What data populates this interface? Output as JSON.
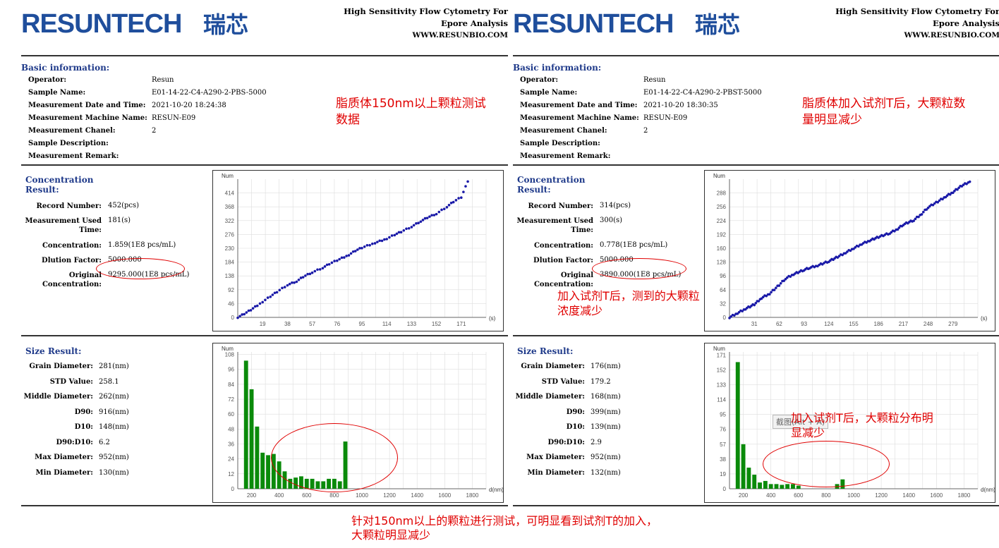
{
  "header": {
    "logo_text": "RESUNTECH 瑞芯",
    "line1": "High Sensitivity Flow Cytometry For",
    "line2": "Epore Analysis",
    "website": "WWW.RESUNBIO.COM"
  },
  "panels": [
    {
      "basic": {
        "title": "Basic information:",
        "rows": [
          {
            "k": "Operator:",
            "v": "Resun"
          },
          {
            "k": "Sample Name:",
            "v": "E01-14-22-C4-A290-2-PBS-5000"
          },
          {
            "k": "Measurement Date and Time:",
            "v": "2021-10-20 18:24:38"
          },
          {
            "k": "Measurement Machine Name:",
            "v": "RESUN-E09"
          },
          {
            "k": "Measurement Chanel:",
            "v": "2"
          },
          {
            "k": "Sample Description:",
            "v": ""
          },
          {
            "k": "Measurement Remark:",
            "v": ""
          }
        ]
      },
      "annotation_top": "脂质体150nm以上颗粒测试数据",
      "concentration": {
        "title_line1": "Concentration",
        "title_line2": "Result:",
        "record_label": "Record Number:",
        "record_value": "452(pcs)",
        "time_label1": "Measurement Used",
        "time_label2": "Time:",
        "time_value": "181(s)",
        "conc_label": "Concentration:",
        "conc_value": "1.859(1E8 pcs/mL)",
        "dil_label": "Dlution Factor:",
        "dil_value": "5000.000",
        "orig_label1": "Original",
        "orig_label2": "Concentration:",
        "orig_value": "9295.000(1E8 pcs/mL)"
      },
      "size": {
        "title": "Size Result:",
        "rows": [
          {
            "k": "Grain Diameter:",
            "v": "281(nm)"
          },
          {
            "k": "STD Value:",
            "v": "258.1"
          },
          {
            "k": "Middle Diameter:",
            "v": "262(nm)"
          },
          {
            "k": "D90:",
            "v": "916(nm)"
          },
          {
            "k": "D10:",
            "v": "148(nm)"
          },
          {
            "k": "D90:D10:",
            "v": "6.2"
          },
          {
            "k": "Max Diameter:",
            "v": "952(nm)"
          },
          {
            "k": "Min Diameter:",
            "v": "130(nm)"
          }
        ]
      },
      "annotation_size": ""
    },
    {
      "basic": {
        "title": "Basic information:",
        "rows": [
          {
            "k": "Operator:",
            "v": "Resun"
          },
          {
            "k": "Sample Name:",
            "v": "E01-14-22-C4-A290-2-PBST-5000"
          },
          {
            "k": "Measurement Date and Time:",
            "v": "2021-10-20 18:30:35"
          },
          {
            "k": "Measurement Machine Name:",
            "v": "RESUN-E09"
          },
          {
            "k": "Measurement Chanel:",
            "v": "2"
          },
          {
            "k": "Sample Description:",
            "v": ""
          },
          {
            "k": "Measurement Remark:",
            "v": ""
          }
        ]
      },
      "annotation_top": "脂质体加入试剂T后，大颗粒数量明显减少",
      "concentration": {
        "title_line1": "Concentration",
        "title_line2": "Result:",
        "record_label": "Record Number:",
        "record_value": "314(pcs)",
        "time_label1": "Measurement Used",
        "time_label2": "Time:",
        "time_value": "300(s)",
        "conc_label": "Concentration:",
        "conc_value": "0.778(1E8 pcs/mL)",
        "dil_label": "Dlution Factor:",
        "dil_value": "5000.000",
        "orig_label1": "Original",
        "orig_label2": "Concentration:",
        "orig_value": "3890.000(1E8 pcs/mL)"
      },
      "annotation_conc": "加入试剂T后，测到的大颗粒浓度减少",
      "size": {
        "title": "Size Result:",
        "rows": [
          {
            "k": "Grain Diameter:",
            "v": "176(nm)"
          },
          {
            "k": "STD Value:",
            "v": "179.2"
          },
          {
            "k": "Middle Diameter:",
            "v": "168(nm)"
          },
          {
            "k": "D90:",
            "v": "399(nm)"
          },
          {
            "k": "D10:",
            "v": "139(nm)"
          },
          {
            "k": "D90:D10:",
            "v": "2.9"
          },
          {
            "k": "Max Diameter:",
            "v": "952(nm)"
          },
          {
            "k": "Min Diameter:",
            "v": "132(nm)"
          }
        ]
      },
      "annotation_size": "加入试剂T后，大颗粒分布明显减少",
      "tooltip": "截图(Alt + A)"
    }
  ],
  "bottom_note_line1": "针对150nm以上的颗粒进行测试，可明显看到试剂T的加入，",
  "bottom_note_line2": "大颗粒明显减少",
  "colors": {
    "title_blue": "#1f3a8a",
    "logo_blue": "#1f4e9c",
    "line_blue": "#1a1aa8",
    "bar_green": "#0a8a0a",
    "annotation_red": "#e00000"
  },
  "chart_data": [
    {
      "type": "scatter",
      "ylabel": "Num",
      "xunit": "(s)",
      "xticks": [
        19,
        38,
        57,
        76,
        95,
        114,
        133,
        152,
        171
      ],
      "yticks": [
        0,
        46,
        92,
        138,
        184,
        230,
        276,
        322,
        368,
        414
      ],
      "xlim": [
        0,
        190
      ],
      "ylim": [
        0,
        460
      ],
      "series": [
        {
          "x": [
            0,
            5,
            10,
            15,
            19,
            25,
            30,
            38,
            45,
            50,
            57,
            65,
            70,
            76,
            85,
            90,
            95,
            105,
            114,
            120,
            125,
            133,
            140,
            145,
            152,
            160,
            165,
            171,
            176
          ],
          "y": [
            0,
            12,
            25,
            40,
            52,
            70,
            85,
            108,
            120,
            135,
            150,
            165,
            178,
            190,
            208,
            222,
            232,
            248,
            262,
            275,
            285,
            302,
            320,
            332,
            345,
            368,
            385,
            400,
            452
          ]
        }
      ]
    },
    {
      "type": "bar",
      "ylabel": "Num",
      "xunit": "d(nm)",
      "xticks": [
        200,
        400,
        600,
        800,
        1000,
        1200,
        1400,
        1600,
        1800
      ],
      "yticks": [
        0,
        12,
        24,
        36,
        48,
        60,
        72,
        84,
        96,
        108
      ],
      "xlim": [
        100,
        1900
      ],
      "ylim": [
        0,
        110
      ],
      "bin_width": 40,
      "x": [
        160,
        200,
        240,
        280,
        320,
        360,
        400,
        440,
        480,
        520,
        560,
        600,
        640,
        680,
        720,
        760,
        800,
        840,
        880,
        920,
        960
      ],
      "values": [
        103,
        80,
        50,
        29,
        27,
        28,
        22,
        14,
        8,
        9,
        10,
        8,
        8,
        6,
        6,
        8,
        8,
        6,
        38,
        0,
        0
      ]
    },
    {
      "type": "scatter",
      "ylabel": "Num",
      "xunit": "(s)",
      "xticks": [
        31,
        62,
        93,
        124,
        155,
        186,
        217,
        248,
        279
      ],
      "yticks": [
        0,
        32,
        64,
        96,
        128,
        160,
        192,
        224,
        256,
        288
      ],
      "xlim": [
        0,
        310
      ],
      "ylim": [
        0,
        320
      ],
      "series": [
        {
          "x": [
            0,
            10,
            20,
            31,
            40,
            50,
            62,
            70,
            80,
            93,
            100,
            110,
            124,
            135,
            145,
            155,
            165,
            175,
            186,
            200,
            210,
            217,
            230,
            240,
            248,
            260,
            270,
            279,
            290,
            300
          ],
          "y": [
            0,
            10,
            20,
            30,
            45,
            55,
            75,
            90,
            100,
            110,
            115,
            120,
            130,
            140,
            150,
            160,
            170,
            178,
            186,
            195,
            205,
            215,
            225,
            240,
            255,
            268,
            280,
            290,
            305,
            314
          ]
        }
      ]
    },
    {
      "type": "bar",
      "ylabel": "Num",
      "xunit": "d(nm)",
      "xticks": [
        200,
        400,
        600,
        800,
        1000,
        1200,
        1400,
        1600,
        1800
      ],
      "yticks": [
        0,
        19,
        38,
        57,
        76,
        95,
        114,
        133,
        152,
        171
      ],
      "xlim": [
        100,
        1900
      ],
      "ylim": [
        0,
        175
      ],
      "bin_width": 40,
      "x": [
        160,
        200,
        240,
        280,
        320,
        360,
        400,
        440,
        480,
        520,
        560,
        600,
        640,
        680,
        720,
        760,
        800,
        840,
        880,
        920,
        960
      ],
      "values": [
        162,
        57,
        27,
        18,
        8,
        10,
        6,
        6,
        5,
        6,
        6,
        4,
        0,
        0,
        0,
        0,
        0,
        0,
        6,
        12,
        0
      ]
    }
  ]
}
